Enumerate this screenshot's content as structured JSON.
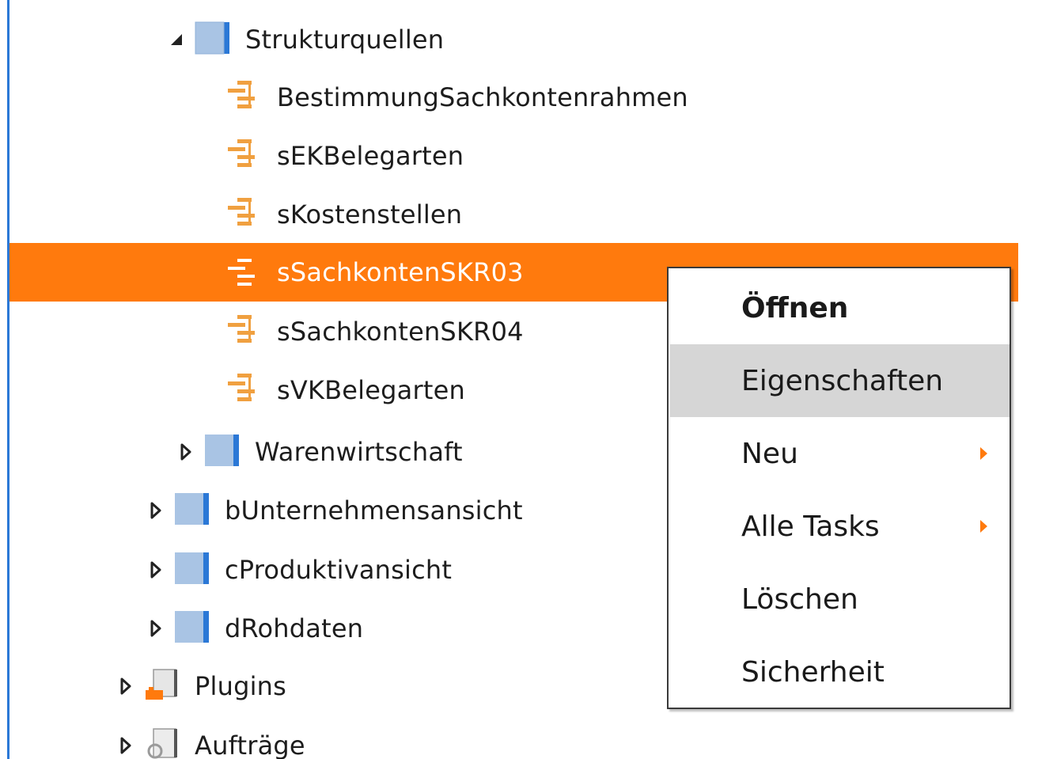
{
  "tree": {
    "items": [
      {
        "label": "Strukturquellen",
        "icon": "folder-icon",
        "toggle": "expanded"
      },
      {
        "label": "BestimmungSachkontenrahmen",
        "icon": "structure-source-icon"
      },
      {
        "label": "sEKBelegarten",
        "icon": "structure-source-icon"
      },
      {
        "label": "sKostenstellen",
        "icon": "structure-source-icon"
      },
      {
        "label": "sSachkontenSKR03",
        "icon": "structure-source-icon",
        "selected": true
      },
      {
        "label": "sSachkontenSKR04",
        "icon": "structure-source-icon"
      },
      {
        "label": "sVKBelegarten",
        "icon": "structure-source-icon"
      },
      {
        "label": "Warenwirtschaft",
        "icon": "folder-icon",
        "toggle": "collapsed"
      },
      {
        "label": "bUnternehmensansicht",
        "icon": "folder-icon",
        "toggle": "collapsed"
      },
      {
        "label": "cProduktivansicht",
        "icon": "folder-icon",
        "toggle": "collapsed"
      },
      {
        "label": "dRohdaten",
        "icon": "folder-icon",
        "toggle": "collapsed"
      },
      {
        "label": "Plugins",
        "icon": "plugin-icon",
        "toggle": "collapsed"
      },
      {
        "label": "Aufträge",
        "icon": "jobs-icon",
        "toggle": "collapsed"
      }
    ]
  },
  "context_menu": {
    "items": [
      {
        "label": "Öffnen",
        "bold": true
      },
      {
        "label": "Eigenschaften",
        "hovered": true
      },
      {
        "label": "Neu",
        "submenu": true
      },
      {
        "label": "Alle Tasks",
        "submenu": true
      },
      {
        "label": "Löschen"
      },
      {
        "label": "Sicherheit"
      }
    ]
  },
  "colors": {
    "selection": "#ff7a0d",
    "accent_border": "#2b78d6",
    "folder_fill": "#a9c4e4",
    "folder_edge": "#2b78d6",
    "structure_icon": "#f0a040",
    "menu_hover": "#d6d6d6"
  }
}
